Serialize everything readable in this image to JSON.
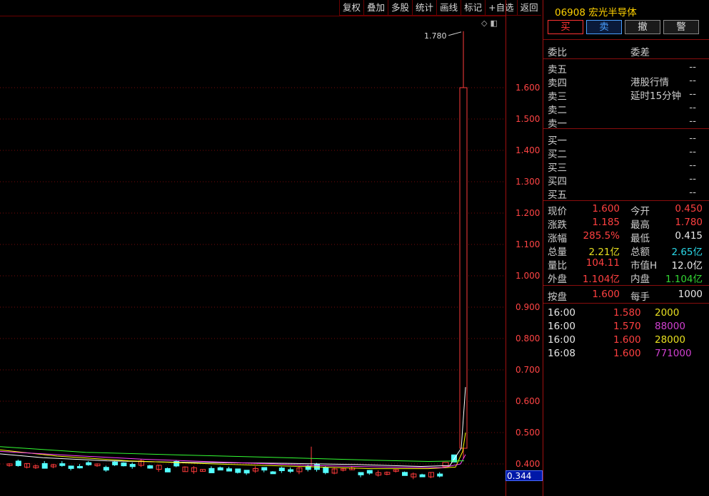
{
  "toolbar": {
    "items": [
      "复权",
      "叠加",
      "多股",
      "统计",
      "画线",
      "标记",
      "+自选",
      "返回"
    ]
  },
  "chart": {
    "price_ticks": [
      "1.600",
      "1.500",
      "1.400",
      "1.300",
      "1.200",
      "1.100",
      "1.000",
      "0.900",
      "0.800",
      "0.700",
      "0.600",
      "0.500",
      "0.400"
    ],
    "high_marker": "1.780",
    "current_cursor_value": "0.344"
  },
  "chart_data": {
    "type": "candlestick",
    "y_axis_ticks": [
      1.6,
      1.5,
      1.4,
      1.3,
      1.2,
      1.1,
      1.0,
      0.9,
      0.8,
      0.7,
      0.6,
      0.5,
      0.4
    ],
    "ylim": [
      0.344,
      1.78
    ],
    "annotations": [
      "1.780"
    ],
    "last_candle": {
      "open": 0.45,
      "high": 1.78,
      "low": 0.415,
      "close": 1.6
    }
  },
  "stock": {
    "code": "06908",
    "name": "宏光半导体"
  },
  "buttons": {
    "buy": "买",
    "sell": "卖",
    "cancel": "撤",
    "alert": "警"
  },
  "ratio": {
    "label_ratio": "委比",
    "label_diff": "委差"
  },
  "asks": [
    {
      "label": "卖五",
      "value": "--"
    },
    {
      "label": "卖四",
      "value": "--"
    },
    {
      "label": "卖三",
      "value": "--"
    },
    {
      "label": "卖二",
      "value": "--"
    },
    {
      "label": "卖一",
      "value": "--"
    }
  ],
  "notice": {
    "line1": "港股行情",
    "line2": "延时15分钟"
  },
  "bids": [
    {
      "label": "买一",
      "value": "--"
    },
    {
      "label": "买二",
      "value": "--"
    },
    {
      "label": "买三",
      "value": "--"
    },
    {
      "label": "买四",
      "value": "--"
    },
    {
      "label": "买五",
      "value": "--"
    }
  ],
  "quote": {
    "price_label": "现价",
    "price": "1.600",
    "open_label": "今开",
    "open": "0.450",
    "change_label": "涨跌",
    "change": "1.185",
    "high_label": "最高",
    "high": "1.780",
    "pct_label": "涨幅",
    "pct": "285.5%",
    "low_label": "最低",
    "low": "0.415",
    "vol_label": "总量",
    "vol": "2.21亿",
    "amount_label": "总额",
    "amount": "2.65亿",
    "vr_label": "量比",
    "vr": "104.11",
    "mcap_label": "市值H",
    "mcap": "12.0亿",
    "outer_label": "外盘",
    "outer": "1.104亿",
    "inner_label": "内盘",
    "inner": "1.104亿",
    "closing_label": "按盘",
    "closing": "1.600",
    "lot_label": "每手",
    "lot": "1000"
  },
  "ticks": [
    {
      "time": "16:00",
      "price": "1.580",
      "volume": "2000",
      "vol_color": "#e8e020"
    },
    {
      "time": "16:00",
      "price": "1.570",
      "volume": "88000",
      "vol_color": "#d040d0"
    },
    {
      "time": "16:00",
      "price": "1.600",
      "volume": "28000",
      "vol_color": "#e8e020"
    },
    {
      "time": "16:08",
      "price": "1.600",
      "volume": "771000",
      "vol_color": "#d040d0"
    }
  ]
}
